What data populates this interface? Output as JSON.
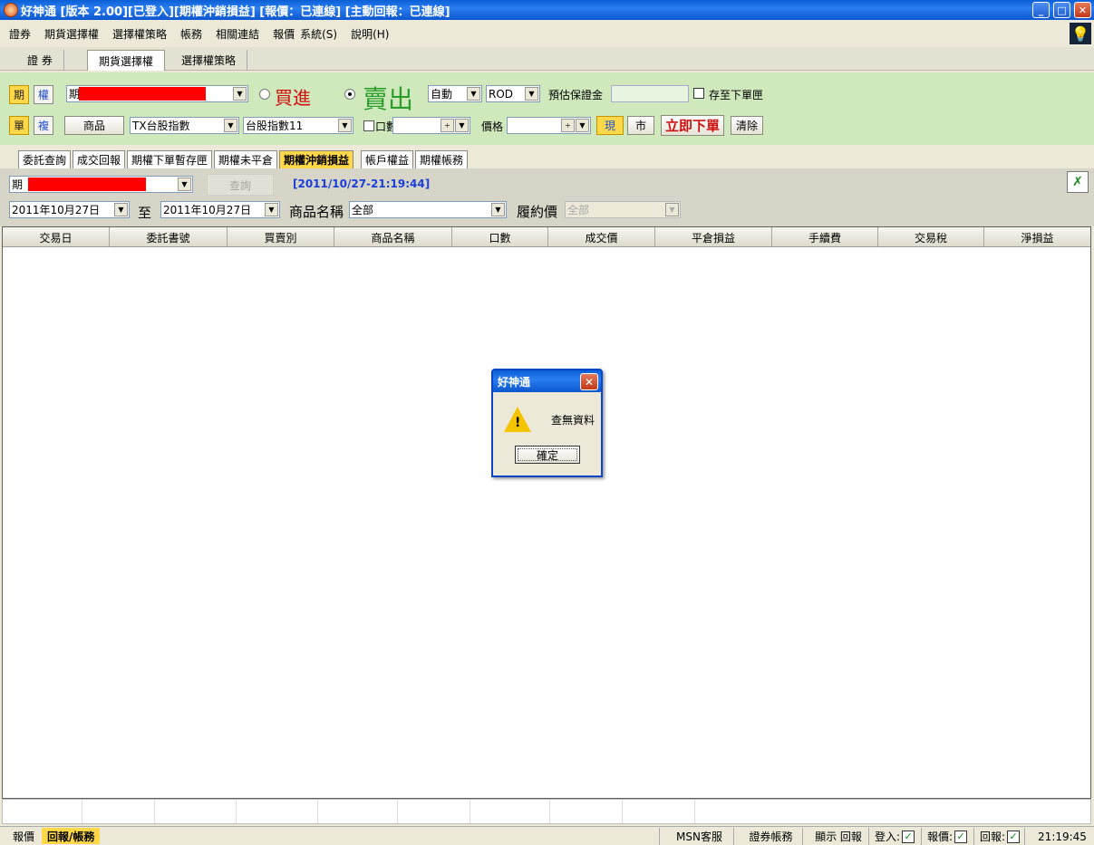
{
  "window": {
    "title": "好神通 [版本 2.00][已登入][期權沖銷損益] [報價：已連線] [主動回報：已連線]"
  },
  "menu": [
    "證券",
    "期貨選擇權",
    "選擇權策略",
    "帳務",
    "相關連結",
    "報價",
    "系統(S)",
    "說明(H)"
  ],
  "main_tabs": [
    "證 券",
    "期貨選擇權",
    "選擇權策略"
  ],
  "order": {
    "mode_future": "期",
    "mode_option": "權",
    "mode_single": "單",
    "mode_complex": "複",
    "account_prefix": "期",
    "buy_label": "買進",
    "sell_label": "賣出",
    "auto_value": "自動",
    "rod_value": "ROD",
    "margin_label": "預估保證金",
    "save_label": "存至下單匣",
    "product_button": "商品",
    "product_value": "TX台股指數",
    "contract_value": "台股指數11",
    "qty_label": "口數",
    "price_label": "價格",
    "spot_button": "現",
    "market_button": "市",
    "submit_button": "立即下單",
    "clear_button": "清除"
  },
  "sub_tabs": [
    "委託查詢",
    "成交回報",
    "期權下單暫存匣",
    "期權未平倉",
    "期權沖銷損益",
    "帳戶權益",
    "期權帳務"
  ],
  "query": {
    "account_prefix": "期",
    "query_button": "查詢",
    "timestamp": "[2011/10/27-21:19:44]",
    "date_from": "2011年10月27日",
    "to_label": "至",
    "date_to": "2011年10月27日",
    "product_name_label": "商品名稱",
    "product_name_value": "全部",
    "strike_label": "履約價",
    "strike_value": "全部"
  },
  "table": {
    "columns": [
      "交易日",
      "委託書號",
      "買賣別",
      "商品名稱",
      "口數",
      "成交價",
      "平倉損益",
      "手續費",
      "交易稅",
      "淨損益"
    ]
  },
  "dialog": {
    "title": "好神通",
    "message": "查無資料",
    "ok": "確定"
  },
  "status": {
    "tab_quote": "報價",
    "tab_report": "回報/帳務",
    "msn": "MSN客服",
    "stock_account": "證券帳務",
    "show_report": "顯示 回報",
    "login": "登入:",
    "quote": "報價:",
    "report": "回報:",
    "check": "✓",
    "time": "21:19:45"
  },
  "colors": {
    "accent_green": "#2a9d2a",
    "buy_red": "#d01010",
    "title_blue": "#0a5fd6",
    "active_tab_yellow": "#ffd84a"
  }
}
